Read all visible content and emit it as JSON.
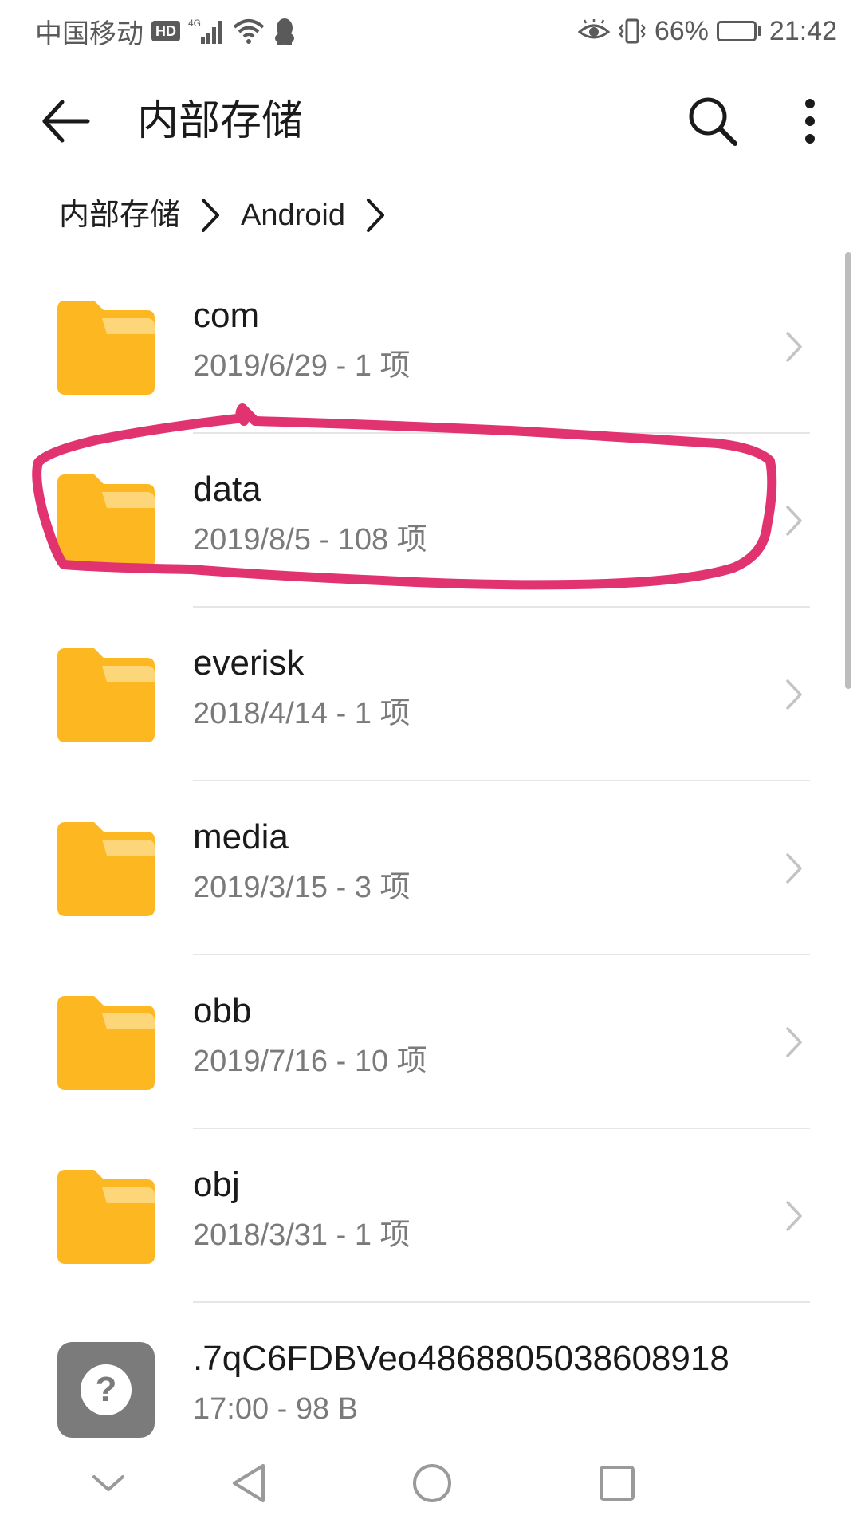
{
  "status_bar": {
    "carrier": "中国移动",
    "hd": "HD",
    "network": "4G",
    "battery": "66%",
    "battery_level": 0.66,
    "time": "21:42"
  },
  "app_bar": {
    "title": "内部存储"
  },
  "breadcrumb": {
    "items": [
      "内部存储",
      "Android"
    ]
  },
  "files": [
    {
      "name": "com",
      "meta": "2019/6/29 - 1 项",
      "icon": "folder-icon"
    },
    {
      "name": "data",
      "meta": "2019/8/5 - 108 项",
      "icon": "folder-icon"
    },
    {
      "name": "everisk",
      "meta": "2018/4/14 - 1 项",
      "icon": "folder-icon"
    },
    {
      "name": "media",
      "meta": "2019/3/15 - 3 项",
      "icon": "folder-icon"
    },
    {
      "name": "obb",
      "meta": "2019/7/16 - 10 项",
      "icon": "folder-icon"
    },
    {
      "name": "obj",
      "meta": "2018/3/31 - 1 项",
      "icon": "folder-icon"
    },
    {
      "name": ".7qC6FDBVeo4868805038608918",
      "meta": "17:00 - 98 B",
      "icon": "unknown-file-icon"
    }
  ],
  "colors": {
    "folder": "#FDB721",
    "folder_tab": "#FDD67A",
    "annotation": "#E0336F",
    "unknown_icon": "#7B7B7B"
  }
}
